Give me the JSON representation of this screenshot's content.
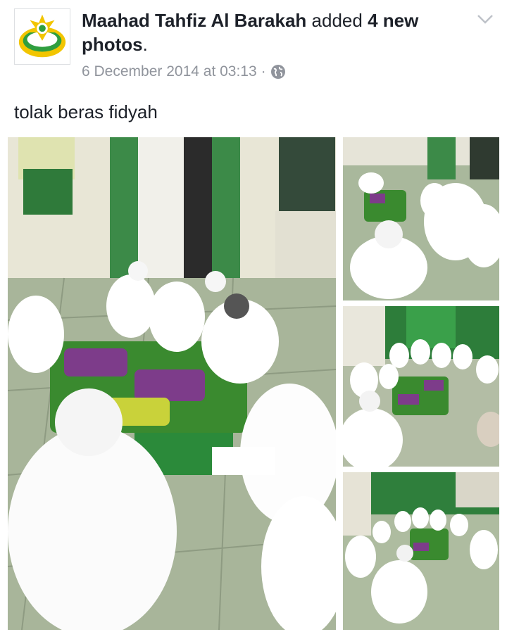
{
  "post": {
    "author": "Maahad Tahfiz Al Barakah",
    "action_text": " added ",
    "object_text": "4 new photos",
    "period": ".",
    "timestamp": "6 December 2014 at 03:13",
    "separator": "·",
    "privacy_icon": "globe-icon",
    "menu_icon": "chevron-down-icon",
    "caption": "tolak beras fidyah"
  },
  "photos": [
    {
      "name": "photo-1"
    },
    {
      "name": "photo-2"
    },
    {
      "name": "photo-3"
    },
    {
      "name": "photo-4"
    }
  ],
  "colors": {
    "text": "#1d2129",
    "meta": "#90949c",
    "logo_green": "#2f9e3f",
    "logo_yellow": "#f2c500"
  }
}
